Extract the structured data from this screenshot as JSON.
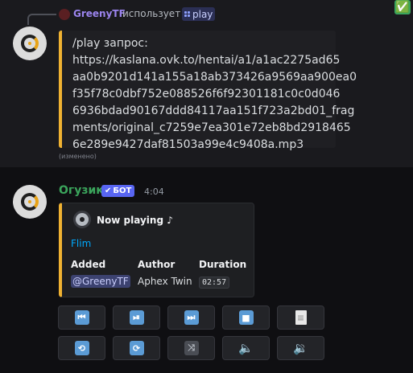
{
  "reply": {
    "username": "GreenyTF",
    "uses_text": "использует",
    "command": "play",
    "badge": "✅"
  },
  "message1": {
    "query_lines": [
      "/play запрос:",
      "https://kaslana.ovk.to/hentai/a1/a1ac2275ad65",
      "aa0b9201d141a155a18ab373426a9569aa900ea0",
      "f35f78c0dbf752e088526f6f92301181c0c0d046",
      "6936bdad90167ddd84117aa151f723a2bd01_frag",
      "ments/original_c7259e7ea301e72eb8bd2918465",
      "6e289e9427daf81503a99e4c9408a.mp3"
    ],
    "edited": "(изменено)"
  },
  "message2": {
    "username": "Огузик",
    "bot_check": "✔",
    "bot_label": "БОТ",
    "time": "4:04",
    "embed": {
      "title": "Now playing ♪",
      "track": "Flim",
      "fields": [
        {
          "name": "Added",
          "value": "@GreenyTF"
        },
        {
          "name": "Author",
          "value": "Aphex Twin"
        },
        {
          "name": "Duration",
          "value": "02:57"
        }
      ]
    }
  },
  "controls": {
    "row1": [
      {
        "name": "previous-track-icon",
        "glyph": "⏮"
      },
      {
        "name": "play-pause-icon",
        "glyph": "⏯"
      },
      {
        "name": "next-track-icon",
        "glyph": "⏭"
      },
      {
        "name": "stop-icon",
        "glyph": "■"
      },
      {
        "name": "queue-document-icon",
        "glyph": "≡"
      }
    ],
    "row2": [
      {
        "name": "repeat-one-icon",
        "glyph": "⟲"
      },
      {
        "name": "repeat-icon",
        "glyph": "⟳"
      },
      {
        "name": "shuffle-icon",
        "glyph": "⤨"
      },
      {
        "name": "volume-down-icon",
        "glyph": "🔈"
      },
      {
        "name": "volume-up-icon",
        "glyph": "🔉"
      }
    ]
  },
  "colors": {
    "accent_bar": "#f0b232",
    "bot_tag": "#5865f2",
    "username_green": "#3ba55c",
    "link_blue": "#00a8fc",
    "button_icon": "#5b9bd5"
  }
}
